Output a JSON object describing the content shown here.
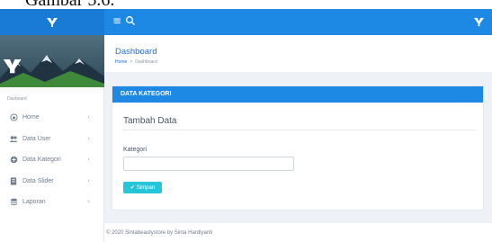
{
  "caption": "Gambar 5.6.",
  "topbar": {
    "menu_icon": "hamburger-icon",
    "search_icon": "search-icon",
    "logo_icon": "brand-logo-icon",
    "color": "#1e88e5"
  },
  "sidebar": {
    "section_title": "Dasboard",
    "items": [
      {
        "label": "Home",
        "icon": "home-icon"
      },
      {
        "label": "Data User",
        "icon": "users-icon"
      },
      {
        "label": "Data Kategori",
        "icon": "category-icon"
      },
      {
        "label": "Data Slider",
        "icon": "slider-icon"
      },
      {
        "label": "Laporan",
        "icon": "report-icon"
      }
    ],
    "caret": "‹"
  },
  "header": {
    "title": "Dashboard",
    "breadcrumb": {
      "home": "Home",
      "separator": ">",
      "current": "Dashboard"
    }
  },
  "card": {
    "heading": "DATA KATEGORI",
    "form_title": "Tambah Data",
    "field_label": "Kategori",
    "field_value": "",
    "save_label": "Simpan",
    "accent": "#26c6da"
  },
  "footer": {
    "text": "© 2020 Sintabeautystore by Sinta Hardiyanti"
  }
}
